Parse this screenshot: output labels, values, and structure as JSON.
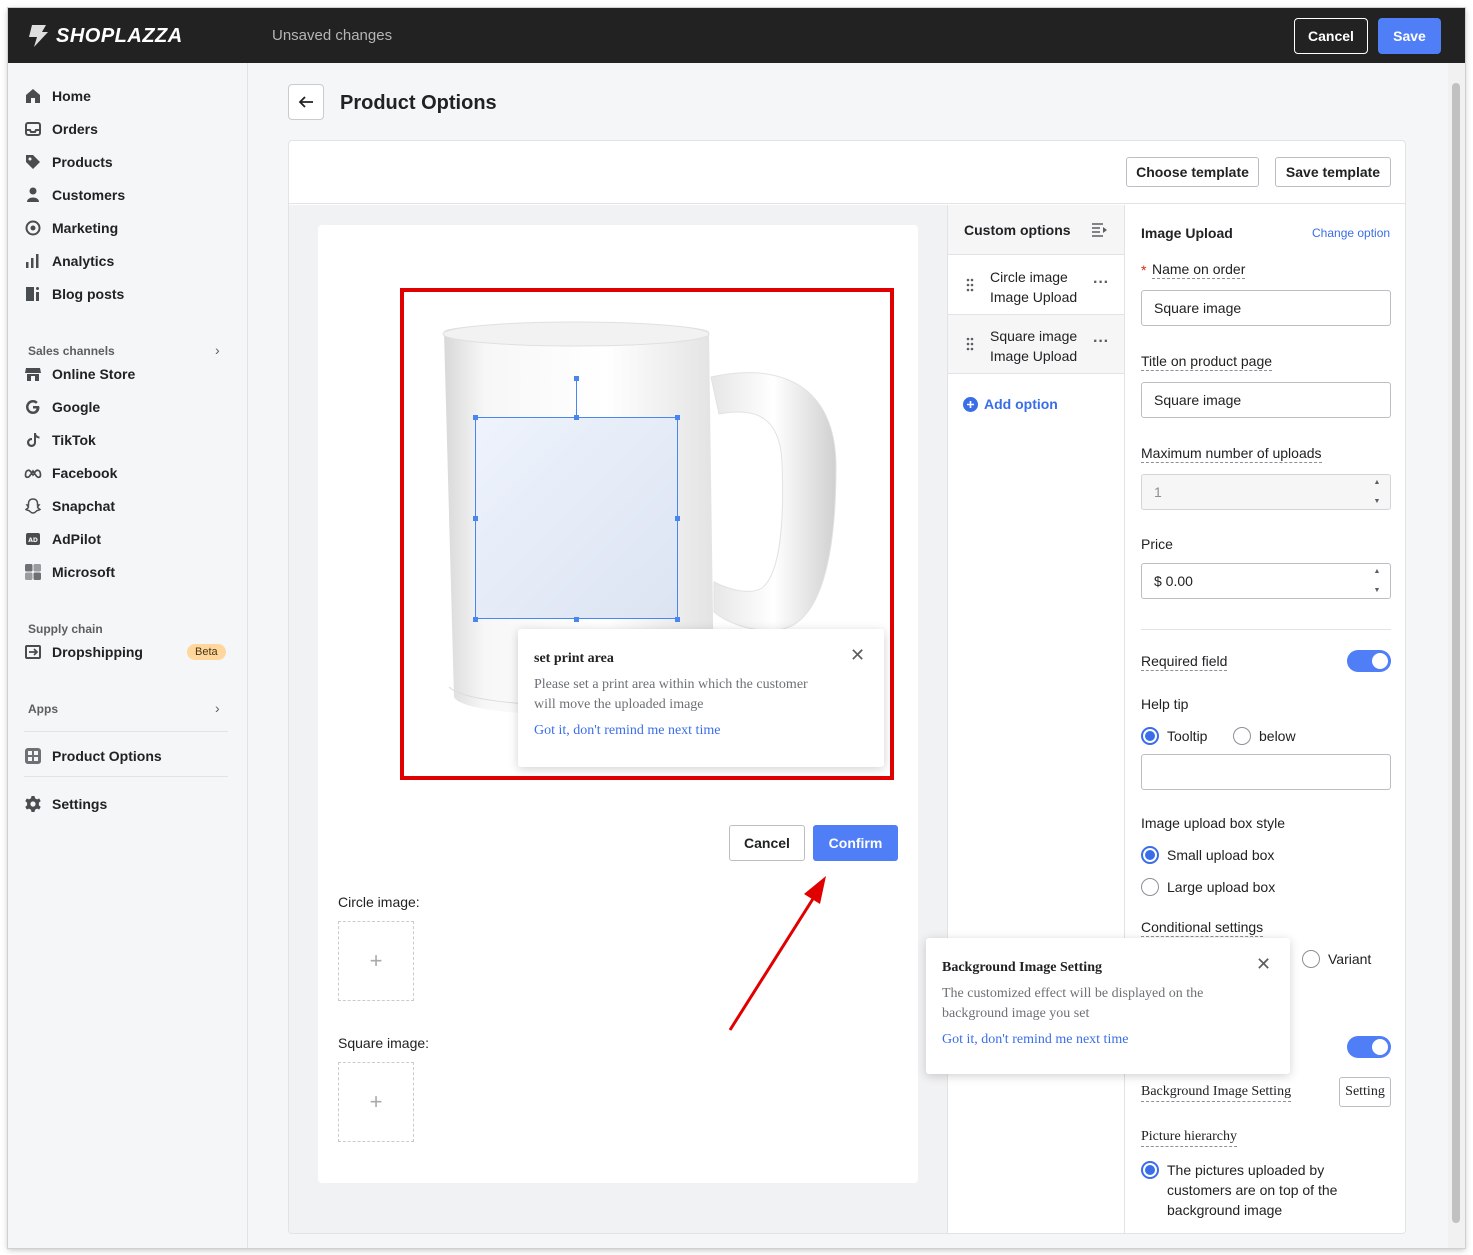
{
  "topbar": {
    "brand": "SHOPLAZZA",
    "status": "Unsaved changes",
    "cancel_label": "Cancel",
    "save_label": "Save"
  },
  "sidebar": {
    "items": [
      {
        "label": "Home",
        "icon": "home-icon"
      },
      {
        "label": "Orders",
        "icon": "orders-icon"
      },
      {
        "label": "Products",
        "icon": "tag-icon"
      },
      {
        "label": "Customers",
        "icon": "person-icon"
      },
      {
        "label": "Marketing",
        "icon": "marketing-icon"
      },
      {
        "label": "Analytics",
        "icon": "bar-chart-icon"
      },
      {
        "label": "Blog posts",
        "icon": "blog-icon"
      }
    ],
    "sales_channels_title": "Sales channels",
    "channels": [
      {
        "label": "Online Store",
        "icon": "store-icon"
      },
      {
        "label": "Google",
        "icon": "google-icon"
      },
      {
        "label": "TikTok",
        "icon": "tiktok-icon"
      },
      {
        "label": "Facebook",
        "icon": "meta-icon"
      },
      {
        "label": "Snapchat",
        "icon": "snapchat-icon"
      },
      {
        "label": "AdPilot",
        "icon": "adpilot-icon"
      },
      {
        "label": "Microsoft",
        "icon": "microsoft-icon"
      }
    ],
    "supply_chain_title": "Supply chain",
    "dropshipping_label": "Dropshipping",
    "beta_badge": "Beta",
    "apps_title": "Apps",
    "product_options_label": "Product Options",
    "settings_label": "Settings"
  },
  "page": {
    "title": "Product Options",
    "choose_template": "Choose template",
    "save_template": "Save template"
  },
  "preview": {
    "print_area_popup": {
      "title": "set print area",
      "body": "Please set a print area within which the customer will move the uploaded image",
      "link": "Got it, don't remind me next time"
    },
    "cancel_label": "Cancel",
    "confirm_label": "Confirm",
    "circle_label": "Circle image:",
    "square_label": "Square image:",
    "plus": "+"
  },
  "options": {
    "title": "Custom options",
    "items": [
      {
        "line1": "Circle image",
        "line2": "Image Upload"
      },
      {
        "line1": "Square image",
        "line2": "Image Upload"
      }
    ],
    "add_label": "Add option",
    "more": "···"
  },
  "settings": {
    "title": "Image Upload",
    "change_option": "Change option",
    "required_mark": "*",
    "name_on_order_label": "Name on order",
    "name_on_order_value": "Square image",
    "title_label": "Title on product page",
    "title_value": "Square image",
    "max_uploads_label": "Maximum number of uploads",
    "max_uploads_value": "1",
    "price_label": "Price",
    "price_value": "$ 0.00",
    "required_label": "Required field",
    "required_on": true,
    "help_tip_label": "Help tip",
    "help_tip_options": [
      "Tooltip",
      "below"
    ],
    "help_tip_selected": "Tooltip",
    "box_style_label": "Image upload box style",
    "box_style_options": [
      "Small upload box",
      "Large upload box"
    ],
    "box_style_selected": "Small upload box",
    "conditional_label": "Conditional settings",
    "conditional_variant": "Variant",
    "bg_toggle_on": true,
    "bg_setting_label": "Background Image Setting",
    "bg_setting_button": "Setting",
    "hierarchy_label": "Picture hierarchy",
    "hierarchy_option": "The pictures uploaded by customers are on top of the background image"
  },
  "bg_popup": {
    "title": "Background Image Setting",
    "body": "The customized effect will be displayed on the background image you set",
    "link": "Got it, don't remind me next time"
  },
  "colors": {
    "accent": "#4f7ef6",
    "highlight": "#e00000",
    "topbar": "#222222"
  }
}
